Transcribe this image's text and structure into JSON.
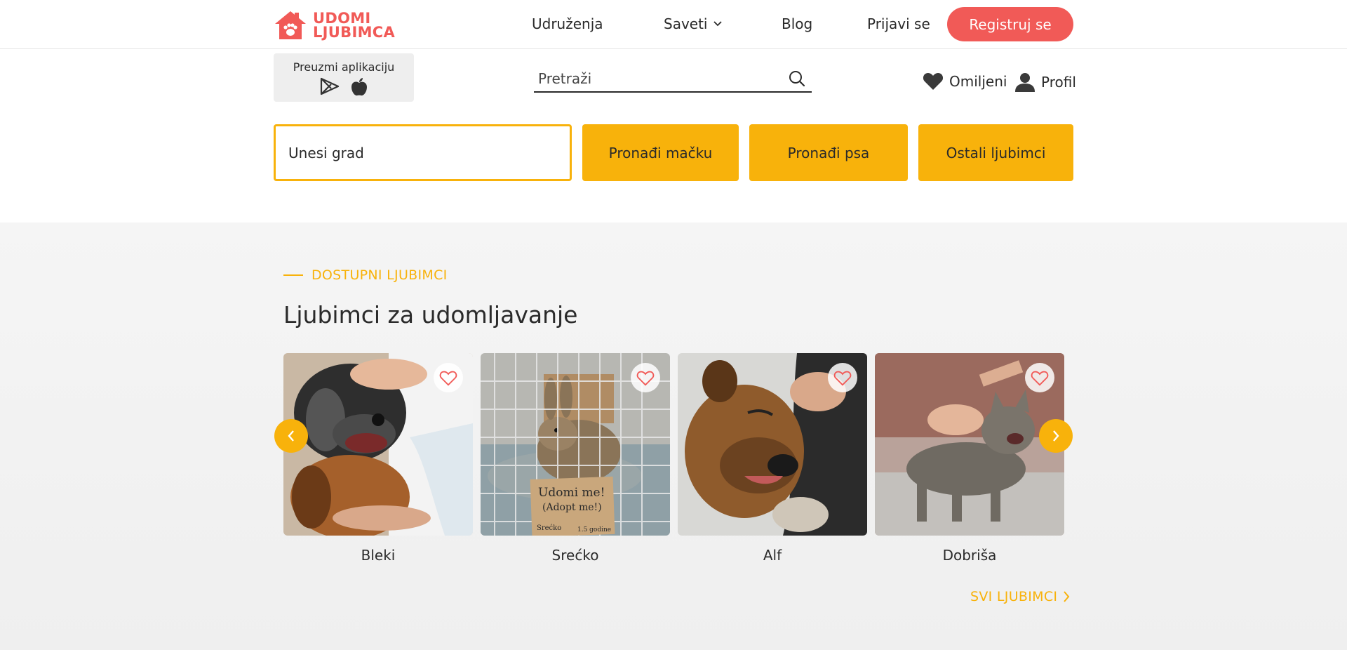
{
  "brand": {
    "logo_line1": "UDOMI",
    "logo_line2": "LJUBIMCA",
    "color": "#f15a57"
  },
  "nav": {
    "associations": "Udruženja",
    "tips": "Saveti",
    "blog": "Blog",
    "login": "Prijavi se",
    "register": "Registruj se"
  },
  "app_download": {
    "title": "Preuzmi aplikaciju",
    "icons": [
      "google-play-icon",
      "apple-icon"
    ]
  },
  "search": {
    "placeholder": "Pretraži"
  },
  "user_links": {
    "favorites": "Omiljeni",
    "profile": "Profil"
  },
  "filters": {
    "city_placeholder": "Unesi grad",
    "find_cat": "Pronađi mačku",
    "find_dog": "Pronađi psa",
    "other_pets": "Ostali ljubimci",
    "accent": "#f8b20b"
  },
  "pets_section": {
    "eyebrow": "DOSTUPNI LJUBIMCI",
    "title": "Ljubimci za udomljavanje",
    "pets": [
      {
        "name": "Bleki"
      },
      {
        "name": "Srećko"
      },
      {
        "name": "Alf"
      },
      {
        "name": "Dobriša"
      }
    ],
    "sign_line1": "Udomi me!",
    "sign_line2": "(Adopt me!)",
    "sign_name": "Srećko",
    "sign_age": "1.5 godine",
    "all_pets": "SVI LJUBIMCI"
  }
}
